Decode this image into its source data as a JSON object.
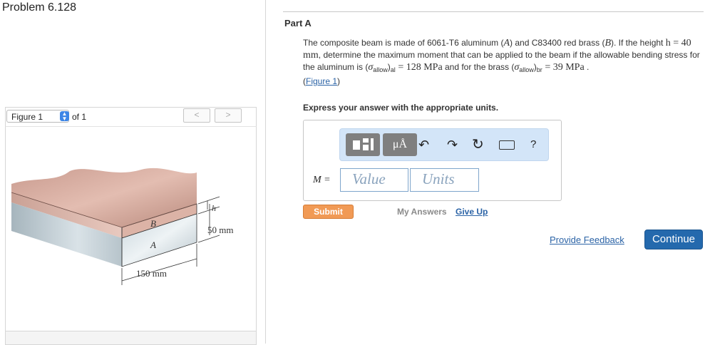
{
  "header": {
    "problem_title": "Problem 6.128"
  },
  "figure_nav": {
    "selected": "Figure 1",
    "of_text": "of 1",
    "prev": "<",
    "next": ">"
  },
  "figure": {
    "label_b": "B",
    "label_a": "A",
    "label_h": "h",
    "dim_height": "50 mm",
    "dim_width": "150 mm"
  },
  "part": {
    "label": "Part A",
    "text_1": "The composite beam is made of 6061-T6 aluminum (",
    "sym_a": "A",
    "text_2": ") and C83400 red brass (",
    "sym_b": "B",
    "text_3": "). If the height ",
    "h_eq": "h = 40 mm",
    "text_4": ", determine the maximum moment that can be applied to the beam if the allowable bending stress for the aluminum is (",
    "sigma": "σ",
    "allow": "allow",
    "al": "al",
    "al_value": " = 128 MPa",
    "text_5": " and for the brass (",
    "br": "br",
    "br_value": " = 39 MPa",
    "text_6": " .",
    "figure_link": "Figure 1"
  },
  "instruction": "Express your answer with the appropriate units.",
  "answer": {
    "m_label": "M =",
    "value_placeholder": "Value",
    "units_placeholder": "Units",
    "unit_button": "μÅ",
    "help": "?"
  },
  "actions": {
    "submit": "Submit",
    "my_answers": "My Answers",
    "give_up": "Give Up",
    "provide_feedback": "Provide Feedback",
    "continue": "Continue"
  },
  "colors": {
    "submit": "#f19a55",
    "continue": "#2469ad",
    "link": "#2b63a6",
    "toolbar": "#d3e5f8"
  }
}
